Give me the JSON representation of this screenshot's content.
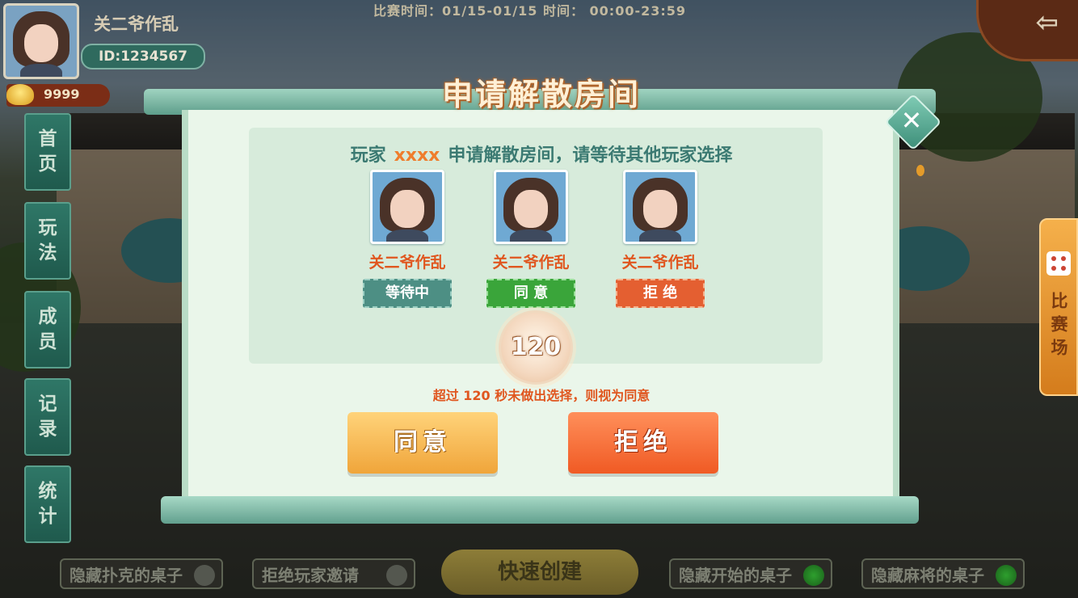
{
  "top": {
    "player_name": "关二爷作乱",
    "player_id": "ID:1234567",
    "gold": "9999",
    "match_time": "比赛时间：01/15-01/15   时间： 00:00-23:59"
  },
  "side_menu": [
    {
      "line1": "首",
      "line2": "页"
    },
    {
      "line1": "玩",
      "line2": "法"
    },
    {
      "line1": "成",
      "line2": "员"
    },
    {
      "line1": "记",
      "line2": "录"
    },
    {
      "line1": "统",
      "line2": "计"
    }
  ],
  "right_tab": {
    "label": "比赛场"
  },
  "bottom": {
    "hide_poker": "隐藏扑克的桌子",
    "refuse_invite": "拒绝玩家邀请",
    "quick_create": "快速创建",
    "hide_started": "隐藏开始的桌子",
    "hide_mahjong": "隐藏麻将的桌子"
  },
  "dialog": {
    "title": "申请解散房间",
    "msg_prefix": "玩家",
    "msg_player": "xxxx",
    "msg_suffix": "申请解散房间，请等待其他玩家选择",
    "voters": [
      {
        "name": "关二爷作乱",
        "status": "等待中"
      },
      {
        "name": "关二爷作乱",
        "status": "同 意"
      },
      {
        "name": "关二爷作乱",
        "status": "拒 绝"
      }
    ],
    "timer": "120",
    "hint": "超过 120 秒未做出选择，则视为同意",
    "agree_label": "同意",
    "refuse_label": "拒绝"
  }
}
